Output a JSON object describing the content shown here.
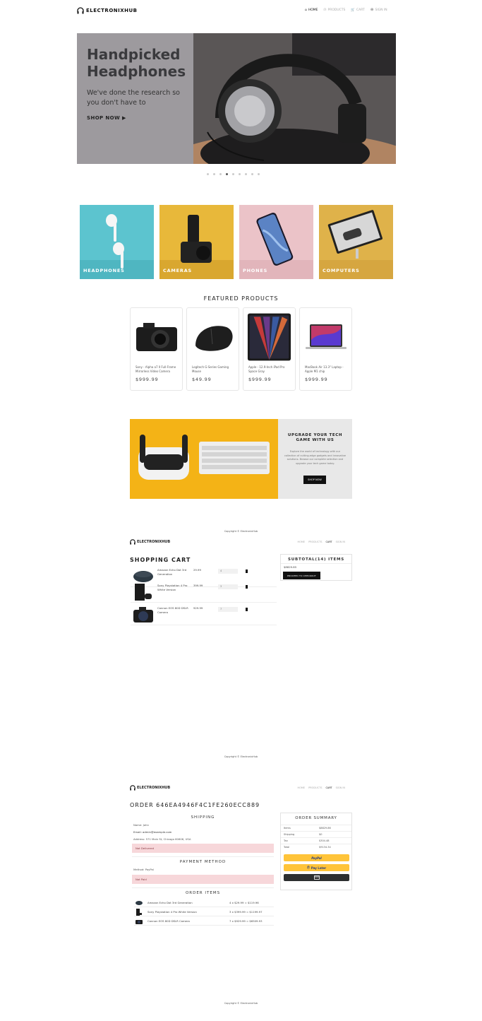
{
  "brand": "ELECTRONIXHUB",
  "nav": {
    "home": "HOME",
    "products": "PRODUCTS",
    "cart": "CART",
    "sign_in": "SIGN IN"
  },
  "hero": {
    "title": "Handpicked Headphones",
    "subtitle": "We've done the research so you don't have to",
    "cta": "SHOP NOW ▶",
    "slide_count": 9,
    "active_slide": 4
  },
  "categories": [
    {
      "label": "HEADPHONES",
      "color": "#5cc4cf"
    },
    {
      "label": "CAMERAS",
      "color": "#e8b83a"
    },
    {
      "label": "PHONES",
      "color": "#ebc3c8"
    },
    {
      "label": "COMPUTERS",
      "color": "#dfb24a"
    }
  ],
  "featured": {
    "title": "FEATURED PRODUCTS",
    "products": [
      {
        "name": "Sony - Alpha a7 II Full-Frame Mirrorless Video Camera",
        "price": "$999.99"
      },
      {
        "name": "Logitech G-Series Gaming Mouse",
        "price": "$49.99"
      },
      {
        "name": "Apple - 12.9-Inch iPad Pro Space Gray",
        "price": "$999.99"
      },
      {
        "name": "MacBook Air 13.3\" Laptop - Apple M1 chip",
        "price": "$999.99"
      }
    ]
  },
  "promo": {
    "title": "UPGRADE YOUR TECH GAME WITH US",
    "text": "Explore the world of technology with our collection of cutting-edge gadgets and innovative solutions. Browse our complete selection and upgrade your tech game today.",
    "button": "SHOP NOW"
  },
  "footer": {
    "copyright": "Copyright © ElectronixHub"
  },
  "cart_page": {
    "title": "SHOPPING CART",
    "items": [
      {
        "name": "Amazon Echo Dot 3rd Generation",
        "price": "29.99",
        "qty": "4"
      },
      {
        "name": "Sony Playstation 4 Pro White Version",
        "price": "399.99",
        "qty": "3"
      },
      {
        "name": "Cannon EOS 80D DSLR Camera",
        "price": "929.99",
        "qty": "7"
      }
    ],
    "subtotal_title": "SUBTOTAL(14) ITEMS",
    "subtotal_amount": "$8829.85",
    "checkout_button": "PROCEED TO CHECKOUT"
  },
  "order_page": {
    "title": "ORDER 646EA4946F4C1FE260ECC889",
    "shipping_title": "SHIPPING",
    "name": "Name: John",
    "email": "Email: admin@example.com",
    "address": "Address: 571 Main St, Chicago 60606, USA",
    "delivery_status": "Not Delivered",
    "payment_title": "PAYMENT METHOD",
    "method": "Method: PayPal",
    "payment_status": "Not Paid",
    "items_title": "ORDER ITEMS",
    "items": [
      {
        "name": "Amazon Echo Dot 3rd Generation",
        "calc": "4 x $29.99 = $119.96"
      },
      {
        "name": "Sony Playstation 4 Pro White Version",
        "calc": "3 x $399.99 = $1199.97"
      },
      {
        "name": "Cannon EOS 80D DSLR Camera",
        "calc": "7 x $929.99 = $6509.93"
      }
    ],
    "summary": {
      "title": "ORDER SUMMARY",
      "rows": [
        {
          "k": "Items",
          "v": "$8829.86"
        },
        {
          "k": "Shipping",
          "v": "$0"
        },
        {
          "k": "Tax",
          "v": "$304.48"
        },
        {
          "k": "Total",
          "v": "$9134.34"
        }
      ],
      "paypal": "PayPal",
      "paylater": "Pay Later"
    }
  }
}
